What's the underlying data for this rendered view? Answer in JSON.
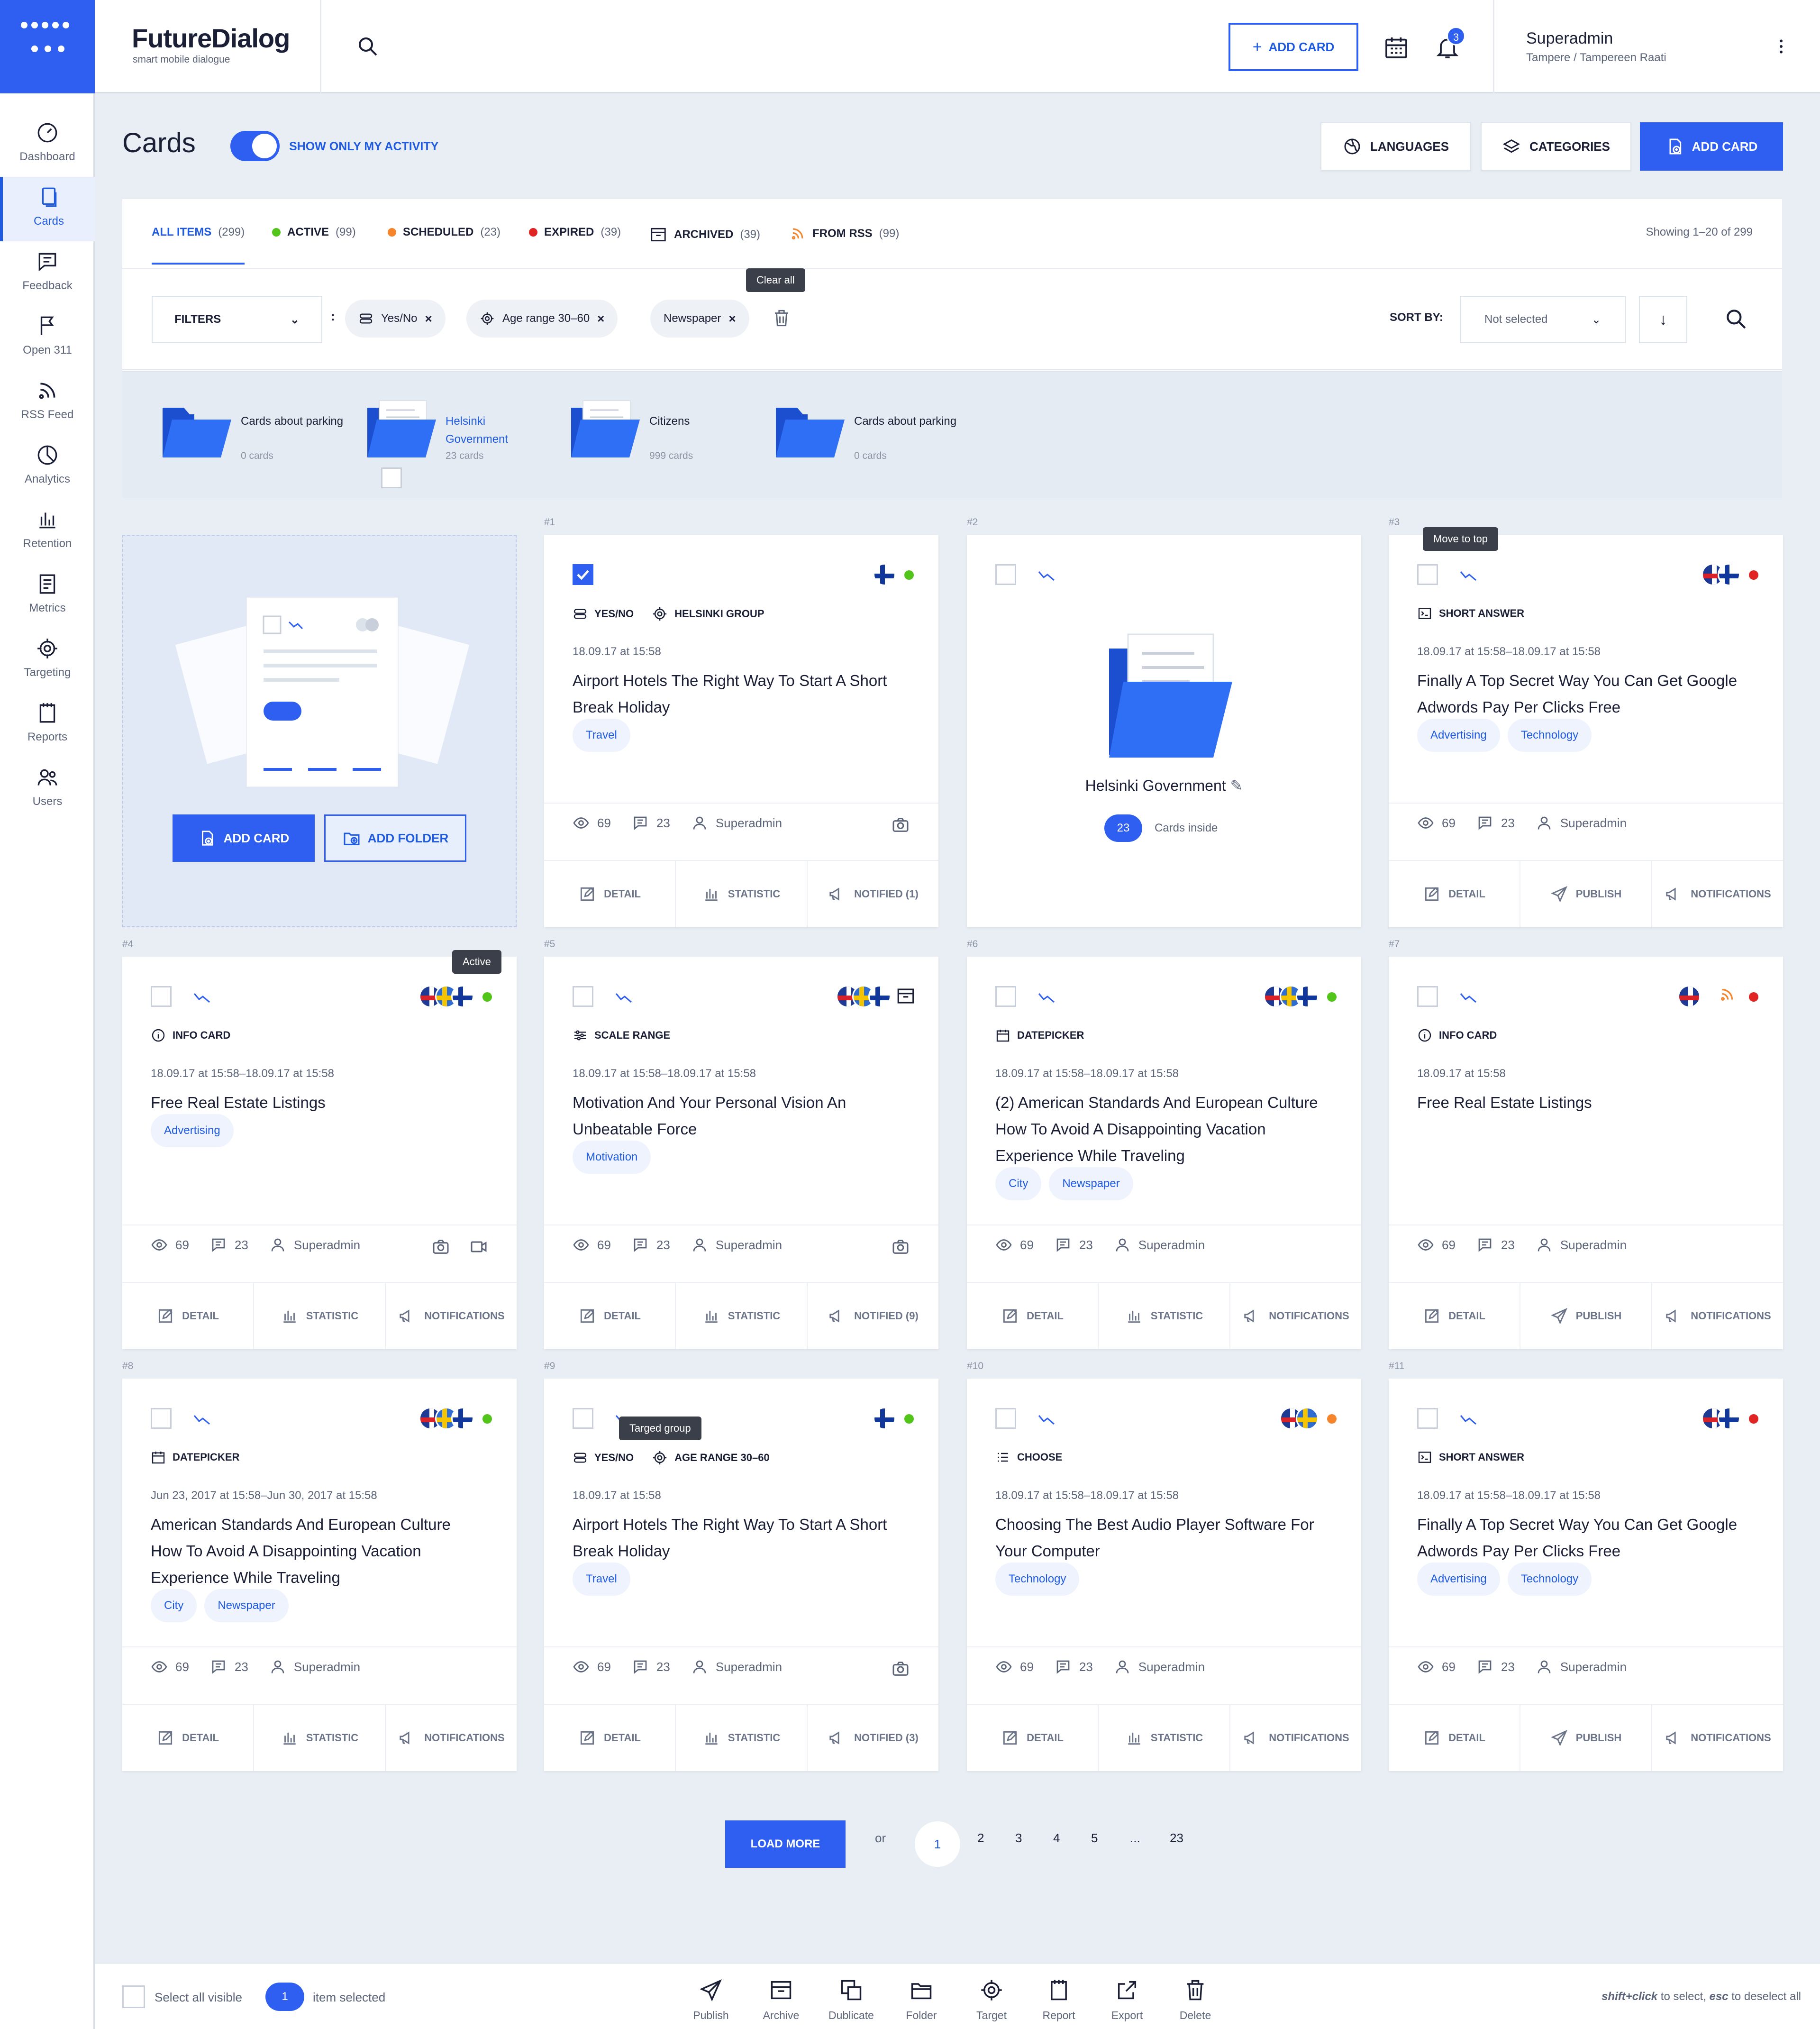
{
  "brand": {
    "name": "FutureDialog",
    "tagline": "smart mobile dialogue"
  },
  "header": {
    "add_card": "ADD CARD",
    "notif_count": "3",
    "user": "Superadmin",
    "location": "Tampere / Tampereen Raati"
  },
  "sidebar": [
    "Dashboard",
    "Cards",
    "Feedback",
    "Open 311",
    "RSS Feed",
    "Analytics",
    "Retention",
    "Metrics",
    "Targeting",
    "Reports",
    "Users"
  ],
  "page": {
    "title": "Cards",
    "toggle_label": "SHOW ONLY MY ACTIVITY",
    "languages": "LANGUAGES",
    "categories": "CATEGORIES",
    "add_card": "ADD CARD"
  },
  "tabs": [
    {
      "label": "ALL ITEMS",
      "count": "(299)"
    },
    {
      "label": "ACTIVE",
      "count": "(99)"
    },
    {
      "label": "SCHEDULED",
      "count": "(23)"
    },
    {
      "label": "EXPIRED",
      "count": "(39)"
    },
    {
      "label": "ARCHIVED",
      "count": "(39)"
    },
    {
      "label": "FROM RSS",
      "count": "(99)"
    }
  ],
  "showing": "Showing 1–20 of 299",
  "filters": {
    "label": "FILTERS",
    "chips": [
      "Yes/No",
      "Age range 30–60",
      "Newspaper"
    ],
    "clear_all": "Clear all",
    "sort_by": "SORT BY:",
    "sort_value": "Not selected",
    "colon": ":"
  },
  "folders": [
    {
      "name": "Cards about parking",
      "count": "0 cards"
    },
    {
      "name": "Helsinki Government",
      "count": "23 cards"
    },
    {
      "name": "Citizens",
      "count": "999 cards"
    },
    {
      "name": "Cards about parking",
      "count": "0 cards"
    }
  ],
  "new_card": {
    "add_card": "ADD CARD",
    "add_folder": "ADD FOLDER"
  },
  "folder_card": {
    "num": "#2",
    "name": "Helsinki Government",
    "count": "23",
    "inside": "Cards inside"
  },
  "tooltips": {
    "move_top": "Move to top",
    "active": "Active",
    "target_group": "Targed group"
  },
  "cards": [
    {
      "num": "#1",
      "type": "YES/NO",
      "type2": "HELSINKI GROUP",
      "date": "18.09.17 at 15:58",
      "title": "Airport Hotels The Right Way To Start A Short Break Holiday",
      "tags": [
        "Travel"
      ],
      "views": "69",
      "comments": "23",
      "author": "Superadmin",
      "a1": "DETAIL",
      "a2": "STATISTIC",
      "a3": "NOTIFIED (1)"
    },
    {
      "num": "#3",
      "type": "SHORT ANSWER",
      "date": "18.09.17 at 15:58–18.09.17 at 15:58",
      "title": "Finally A Top Secret Way You Can Get Google Adwords Pay Per Clicks Free",
      "tags": [
        "Advertising",
        "Technology"
      ],
      "views": "69",
      "comments": "23",
      "author": "Superadmin",
      "a1": "DETAIL",
      "a2": "PUBLISH",
      "a3": "NOTIFICATIONS"
    },
    {
      "num": "#4",
      "type": "INFO CARD",
      "date": "18.09.17 at 15:58–18.09.17 at 15:58",
      "title": "Free Real Estate Listings",
      "tags": [
        "Advertising"
      ],
      "views": "69",
      "comments": "23",
      "author": "Superadmin",
      "a1": "DETAIL",
      "a2": "STATISTIC",
      "a3": "NOTIFICATIONS"
    },
    {
      "num": "#5",
      "type": "SCALE RANGE",
      "date": "18.09.17 at 15:58–18.09.17 at 15:58",
      "title": "Motivation And Your Personal Vision An Unbeatable Force",
      "tags": [
        "Motivation"
      ],
      "views": "69",
      "comments": "23",
      "author": "Superadmin",
      "a1": "DETAIL",
      "a2": "STATISTIC",
      "a3": "NOTIFIED (9)"
    },
    {
      "num": "#6",
      "type": "DATEPICKER",
      "date": "18.09.17 at 15:58–18.09.17 at 15:58",
      "title": "(2) American Standards And European Culture How To Avoid A Disappointing Vacation Experience While Traveling",
      "tags": [
        "City",
        "Newspaper"
      ],
      "views": "69",
      "comments": "23",
      "author": "Superadmin",
      "a1": "DETAIL",
      "a2": "STATISTIC",
      "a3": "NOTIFICATIONS"
    },
    {
      "num": "#7",
      "type": "INFO CARD",
      "date": "18.09.17 at 15:58",
      "title": "Free Real Estate Listings",
      "tags": [],
      "views": "69",
      "comments": "23",
      "author": "Superadmin",
      "a1": "DETAIL",
      "a2": "PUBLISH",
      "a3": "NOTIFICATIONS"
    },
    {
      "num": "#8",
      "type": "DATEPICKER",
      "date": "Jun 23, 2017 at 15:58–Jun 30, 2017 at 15:58",
      "title": "American Standards And European Culture How To Avoid A Disappointing Vacation Experience While Traveling",
      "tags": [
        "City",
        "Newspaper"
      ],
      "views": "69",
      "comments": "23",
      "author": "Superadmin",
      "a1": "DETAIL",
      "a2": "STATISTIC",
      "a3": "NOTIFICATIONS"
    },
    {
      "num": "#9",
      "type": "YES/NO",
      "type2": "AGE RANGE 30–60",
      "date": "18.09.17 at 15:58",
      "title": "Airport Hotels The Right Way To Start A Short Break Holiday",
      "tags": [
        "Travel"
      ],
      "views": "69",
      "comments": "23",
      "author": "Superadmin",
      "a1": "DETAIL",
      "a2": "STATISTIC",
      "a3": "NOTIFIED (3)"
    },
    {
      "num": "#10",
      "type": "CHOOSE",
      "date": "18.09.17 at 15:58–18.09.17 at 15:58",
      "title": "Choosing The Best Audio Player Software For Your Computer",
      "tags": [
        "Technology"
      ],
      "views": "69",
      "comments": "23",
      "author": "Superadmin",
      "a1": "DETAIL",
      "a2": "STATISTIC",
      "a3": "NOTIFICATIONS"
    },
    {
      "num": "#11",
      "type": "SHORT ANSWER",
      "date": "18.09.17 at 15:58–18.09.17 at 15:58",
      "title": "Finally A Top Secret Way You Can Get Google Adwords Pay Per Clicks Free",
      "tags": [
        "Advertising",
        "Technology"
      ],
      "views": "69",
      "comments": "23",
      "author": "Superadmin",
      "a1": "DETAIL",
      "a2": "PUBLISH",
      "a3": "NOTIFICATIONS"
    }
  ],
  "pagination": {
    "load_more": "LOAD MORE",
    "or": "or",
    "pages": [
      "1",
      "2",
      "3",
      "4",
      "5",
      "...",
      "23"
    ]
  },
  "bottom": {
    "select_all": "Select all visible",
    "selected_count": "1",
    "selected_text": "item selected",
    "actions": [
      "Publish",
      "Archive",
      "Dublicate",
      "Folder",
      "Target",
      "Report",
      "Export",
      "Delete"
    ],
    "hint_key1": "shift+click",
    "hint1": " to select, ",
    "hint_key2": "esc",
    "hint2": " to deselect all"
  },
  "colors": {
    "accent": "#2f5ff0",
    "active": "#52c41a",
    "scheduled": "#f5842a",
    "expired": "#e02424",
    "rss": "#f5842a"
  }
}
